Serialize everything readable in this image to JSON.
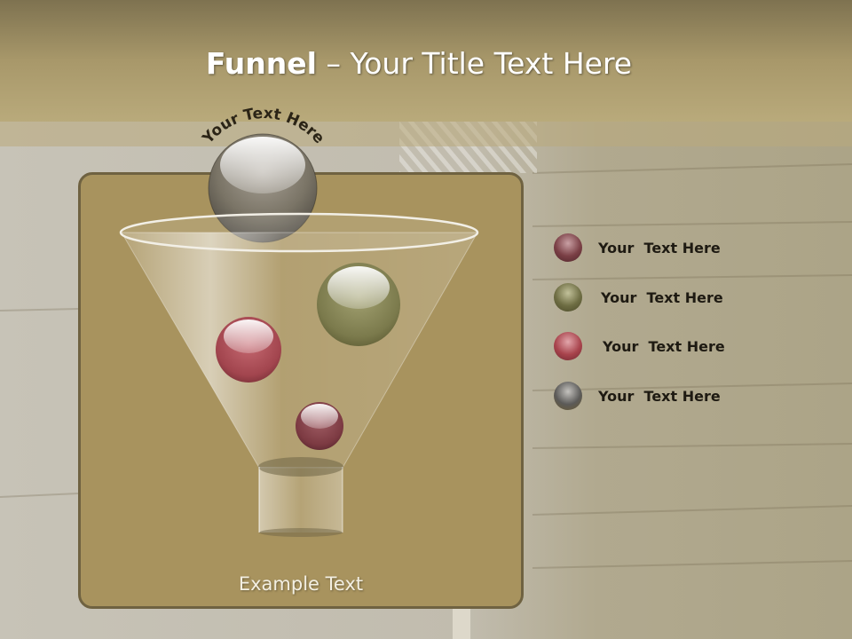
{
  "slide": {
    "title_bold": "Funnel",
    "title_dash": "–",
    "title_rest": "Your Title Text Here"
  },
  "funnel": {
    "top_label": "Your Text Here",
    "footer_label": "Example Text",
    "balls": [
      {
        "name": "ball-top",
        "color": "#6f6c67"
      },
      {
        "name": "ball-olive",
        "color": "#7b7a4c"
      },
      {
        "name": "ball-red",
        "color": "#a2454e"
      },
      {
        "name": "ball-maroon",
        "color": "#7c3a42"
      }
    ]
  },
  "legend": {
    "items": [
      {
        "label": "Your  Text Here",
        "color": "#7a3f45"
      },
      {
        "label": "Your  Text Here",
        "color": "#6e6d43"
      },
      {
        "label": "Your  Text Here",
        "color": "#a8434c"
      },
      {
        "label": "Your  Text Here",
        "color": "#5b5a58"
      }
    ]
  }
}
